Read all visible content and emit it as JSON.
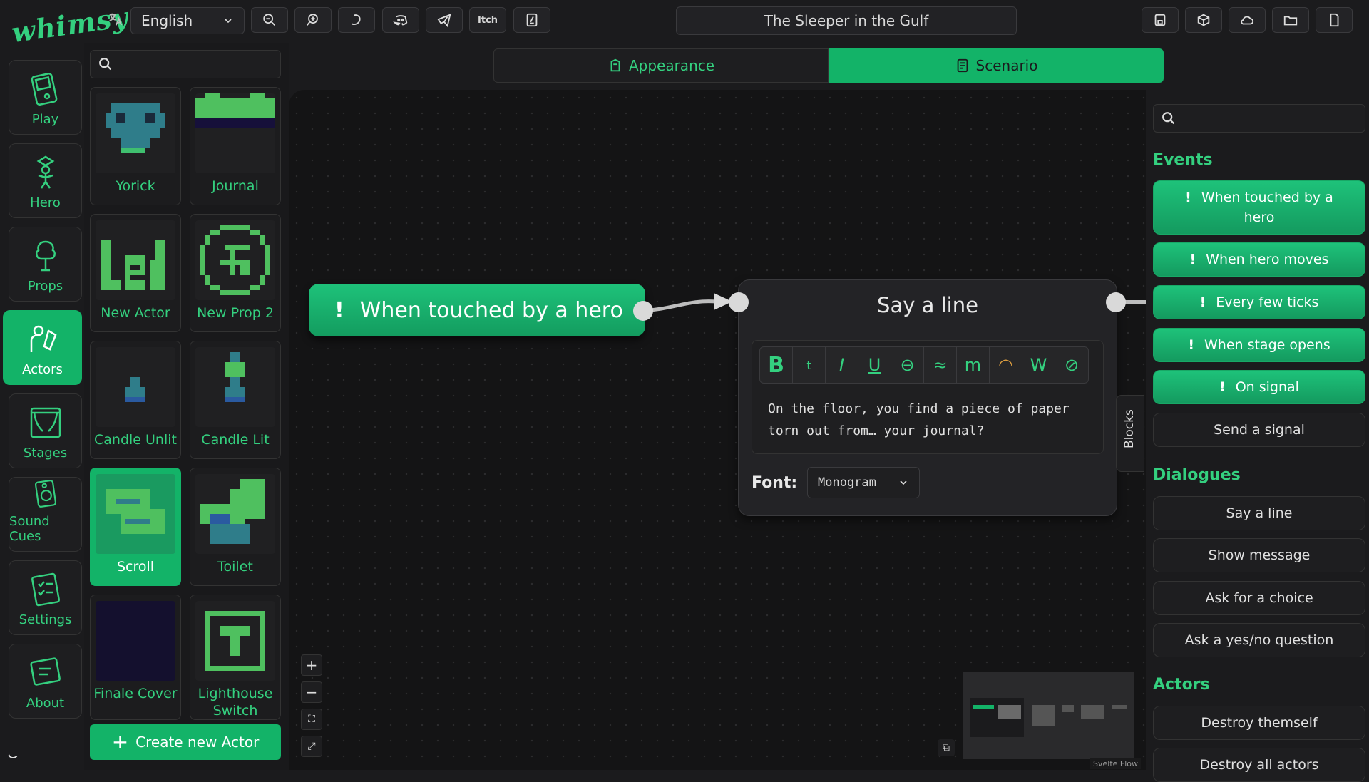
{
  "app": {
    "logo": "whimsy",
    "project_title": "The Sleeper in the Gulf"
  },
  "toolbar": {
    "language": "English",
    "itch_label": "Itch"
  },
  "nav": {
    "items": [
      {
        "label": "Play"
      },
      {
        "label": "Hero"
      },
      {
        "label": "Props"
      },
      {
        "label": "Actors"
      },
      {
        "label": "Stages"
      },
      {
        "label": "Sound Cues"
      },
      {
        "label": "Settings"
      },
      {
        "label": "About"
      }
    ]
  },
  "assets": {
    "items": [
      {
        "label": "Yorick"
      },
      {
        "label": "Journal"
      },
      {
        "label": "New Actor"
      },
      {
        "label": "New Prop 2"
      },
      {
        "label": "Candle Unlit"
      },
      {
        "label": "Candle Lit"
      },
      {
        "label": "Scroll"
      },
      {
        "label": "Toilet"
      },
      {
        "label": "Finale Cover"
      },
      {
        "label": "Lighthouse Switch"
      }
    ],
    "create_label": "Create new Actor"
  },
  "tabs": {
    "appearance": "Appearance",
    "scenario": "Scenario"
  },
  "canvas": {
    "event_node": {
      "label": "When touched by a hero"
    },
    "say_node": {
      "title": "Say a line",
      "text": "On the floor, you find a piece of paper torn out from… your journal?",
      "font_label": "Font:",
      "font_value": "Monogram"
    },
    "blocks_tab": "Blocks",
    "attribution": "Svelte Flow"
  },
  "palette": {
    "events_heading": "Events",
    "events": [
      {
        "label": "When touched by a hero"
      },
      {
        "label": "When hero moves"
      },
      {
        "label": "Every few ticks"
      },
      {
        "label": "When stage opens"
      },
      {
        "label": "On signal"
      }
    ],
    "send_signal": "Send a signal",
    "dialogues_heading": "Dialogues",
    "dialogues": [
      {
        "label": "Say a line"
      },
      {
        "label": "Show message"
      },
      {
        "label": "Ask for a choice"
      },
      {
        "label": "Ask a yes/no question"
      }
    ],
    "actors_heading": "Actors",
    "actors": [
      {
        "label": "Destroy themself"
      },
      {
        "label": "Destroy all actors"
      }
    ]
  },
  "colors": {
    "accent": "#34d07f",
    "accent_fill": "#13b368",
    "background": "#1b1b1d",
    "canvas": "#141415"
  }
}
